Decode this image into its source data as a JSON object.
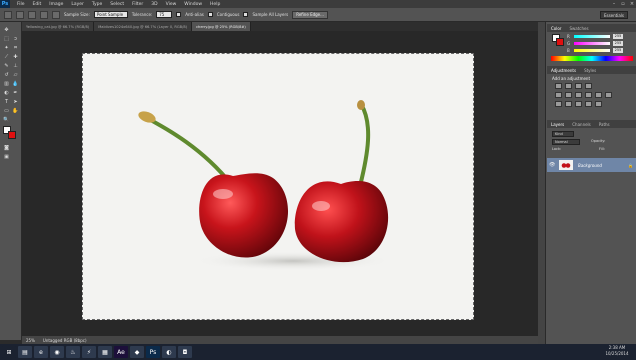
{
  "app": {
    "logo": "Ps"
  },
  "menu": [
    "File",
    "Edit",
    "Image",
    "Layer",
    "Type",
    "Select",
    "Filter",
    "3D",
    "View",
    "Window",
    "Help"
  ],
  "options": {
    "sample_size_label": "Sample Size:",
    "sample_size_value": "Point Sample",
    "tolerance_label": "Tolerance:",
    "tolerance_value": "75",
    "antialias_label": "Anti-alias",
    "contiguous_label": "Contiguous",
    "sample_all_label": "Sample All Layers",
    "refine_edge_label": "Refine Edge...",
    "workspace": "Essentials"
  },
  "tabs": [
    {
      "label": "Yellowing_cat.jpg @ 66.7% (RGB/8)",
      "active": false
    },
    {
      "label": "Maldives1024x640.jpg @ 66.7% (Layer 0, RGB/8)",
      "active": false
    },
    {
      "label": "cherry.jpg @ 25% (RGB/8#)",
      "active": true
    }
  ],
  "status": {
    "zoom": "25%",
    "doc_info": "Untagged RGB (8bpc)"
  },
  "color_panel": {
    "tabs": [
      "Color",
      "Swatches"
    ],
    "channels": [
      {
        "ch": "R",
        "value": "255"
      },
      {
        "ch": "G",
        "value": "255"
      },
      {
        "ch": "B",
        "value": "255"
      }
    ],
    "fg": "#ffffff",
    "bg": "#e01010"
  },
  "adjustments_panel": {
    "tabs": [
      "Adjustments",
      "Styles"
    ],
    "heading": "Add an adjustment"
  },
  "layers_panel": {
    "tabs": [
      "Layers",
      "Channels",
      "Paths"
    ],
    "kind_label": "Kind",
    "blend_mode": "Normal",
    "opacity_label": "Opacity:",
    "fill_label": "Fill:",
    "lock_label": "Lock:",
    "layer_name": "Background"
  },
  "taskbar": {
    "apps": [
      {
        "name": "windows-start-icon",
        "glyph": "⊞",
        "color": "#1b2230"
      },
      {
        "name": "explorer-icon",
        "glyph": "▤",
        "color": "#2e3a4e"
      },
      {
        "name": "ie-icon",
        "glyph": "e",
        "color": "#2e3a4e"
      },
      {
        "name": "chrome-icon",
        "glyph": "◉",
        "color": "#2e3a4e"
      },
      {
        "name": "steam-icon",
        "glyph": "♨",
        "color": "#2e3a4e"
      },
      {
        "name": "winamp-icon",
        "glyph": "⚡",
        "color": "#2e3a4e"
      },
      {
        "name": "folder-icon",
        "glyph": "▦",
        "color": "#2e3a4e"
      },
      {
        "name": "aftereffects-icon",
        "glyph": "Ae",
        "color": "#1c0f3a"
      },
      {
        "name": "illustrator-icon",
        "glyph": "◆",
        "color": "#2e3a4e"
      },
      {
        "name": "photoshop-icon",
        "glyph": "Ps",
        "color": "#0b2a4a"
      },
      {
        "name": "media-icon",
        "glyph": "◐",
        "color": "#2e3a4e"
      },
      {
        "name": "camera-icon",
        "glyph": "◘",
        "color": "#2e3a4e"
      }
    ],
    "time": "2:38 AM",
    "date": "10/25/2014"
  },
  "colors": {
    "accent": "#39a9ff",
    "cherry": "#c2121a",
    "stem": "#6f9a3c"
  }
}
